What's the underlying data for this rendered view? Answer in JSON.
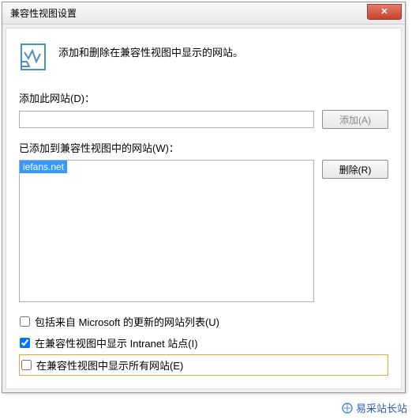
{
  "titlebar": {
    "title": "兼容性视图设置"
  },
  "header": {
    "description": "添加和删除在兼容性视图中显示的网站。"
  },
  "addSection": {
    "label": "添加此网站(D)：",
    "inputValue": "",
    "addButton": "添加(A)"
  },
  "listSection": {
    "label": "已添加到兼容性视图中的网站(W)：",
    "items": [
      "iefans.net"
    ],
    "removeButton": "删除(R)"
  },
  "checkboxes": {
    "msUpdate": {
      "label": "包括来自 Microsoft 的更新的网站列表(U)",
      "checked": false
    },
    "intranet": {
      "label": "在兼容性视图中显示 Intranet 站点(I)",
      "checked": true
    },
    "allSites": {
      "label": "在兼容性视图中显示所有网站(E)",
      "checked": false
    }
  },
  "watermark": {
    "text": "易采站长站"
  }
}
